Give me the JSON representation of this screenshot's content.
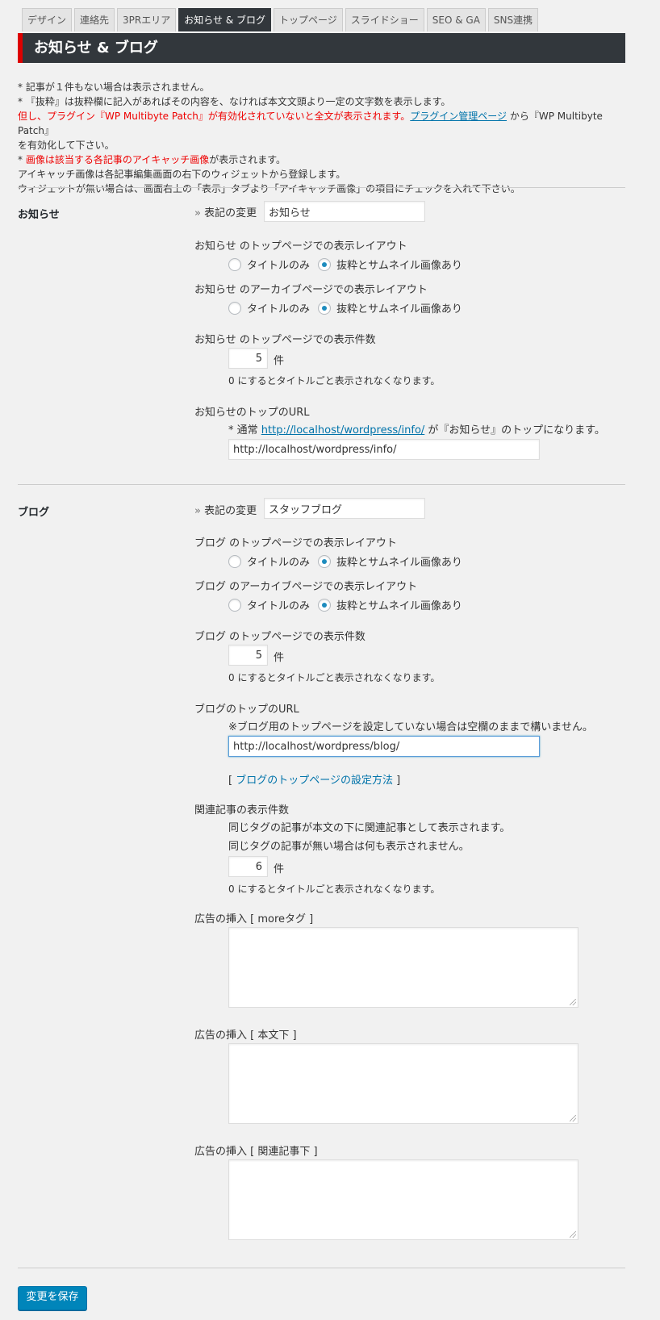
{
  "tabs": [
    "デザイン",
    "連絡先",
    "3PRエリア",
    "お知らせ & ブログ",
    "トップページ",
    "スライドショー",
    "SEO & GA",
    "SNS連携"
  ],
  "header": {
    "title": "お知らせ & ブログ"
  },
  "notes": {
    "line1": "* 記事が１件もない場合は表示されません。",
    "line2": "* 『抜粋』は抜粋欄に記入があればその内容を、なければ本文文頭より一定の文字数を表示します。",
    "line3_red": "但し、プラグイン『WP Multibyte Patch』が有効化されていないと全文が表示されます。",
    "line3_link": "プラグイン管理ページ",
    "line3_tail": " から『WP Multibyte Patch』",
    "line4": "を有効化して下さい。",
    "line5_prefix": "* ",
    "line5_red": "画像は該当する各記事のアイキャッチ画像",
    "line5_tail": "が表示されます。",
    "line6": "アイキャッチ画像は各記事編集画面の右下のウィジェットから登録します。",
    "line7": "ウィジェットが無い場合は、画面右上の「表示」タブより「アイキャッチ画像」の項目にチェックを入れて下さい。"
  },
  "info": {
    "title": "お知らせ",
    "rename_label": "表記の変更",
    "rename_value": "お知らせ",
    "top_layout_label": "お知らせ のトップページでの表示レイアウト",
    "archive_layout_label": "お知らせ のアーカイブページでの表示レイアウト",
    "option_title_only": "タイトルのみ",
    "option_excerpt_thumb": "抜粋とサムネイル画像あり",
    "count_label": "お知らせ のトップページでの表示件数",
    "count_value": "5",
    "count_unit": "件",
    "count_note": "0 にするとタイトルごと表示されなくなります。",
    "url_label": "お知らせのトップのURL",
    "url_note_prefix": "* 通常 ",
    "url_note_link": "http://localhost/wordpress/info/",
    "url_note_tail": " が『お知らせ』のトップになります。",
    "url_value": "http://localhost/wordpress/info/"
  },
  "blog": {
    "title": "ブログ",
    "rename_label": "表記の変更",
    "rename_value": "スタッフブログ",
    "top_layout_label": "ブログ のトップページでの表示レイアウト",
    "archive_layout_label": "ブログ のアーカイブページでの表示レイアウト",
    "option_title_only": "タイトルのみ",
    "option_excerpt_thumb": "抜粋とサムネイル画像あり",
    "count_label": "ブログ のトップページでの表示件数",
    "count_value": "5",
    "count_unit": "件",
    "count_note": "0 にするとタイトルごと表示されなくなります。",
    "url_label": "ブログのトップのURL",
    "url_note": "※ブログ用のトップページを設定していない場合は空欄のままで構いません。",
    "url_value": "http://localhost/wordpress/blog/",
    "howto_open": "[ ",
    "howto_link": "ブログのトップページの設定方法",
    "howto_close": " ]",
    "related_label": "関連記事の表示件数",
    "related_note1": "同じタグの記事が本文の下に関連記事として表示されます。",
    "related_note2": "同じタグの記事が無い場合は何も表示されません。",
    "related_value": "6",
    "related_unit": "件",
    "related_zero_note": "0 にするとタイトルごと表示されなくなります。",
    "ad_more_label": "広告の挿入 [ moreタグ ]",
    "ad_body_label": "広告の挿入 [ 本文下 ]",
    "ad_related_label": "広告の挿入 [ 関連記事下 ]"
  },
  "save_label": "変更を保存"
}
